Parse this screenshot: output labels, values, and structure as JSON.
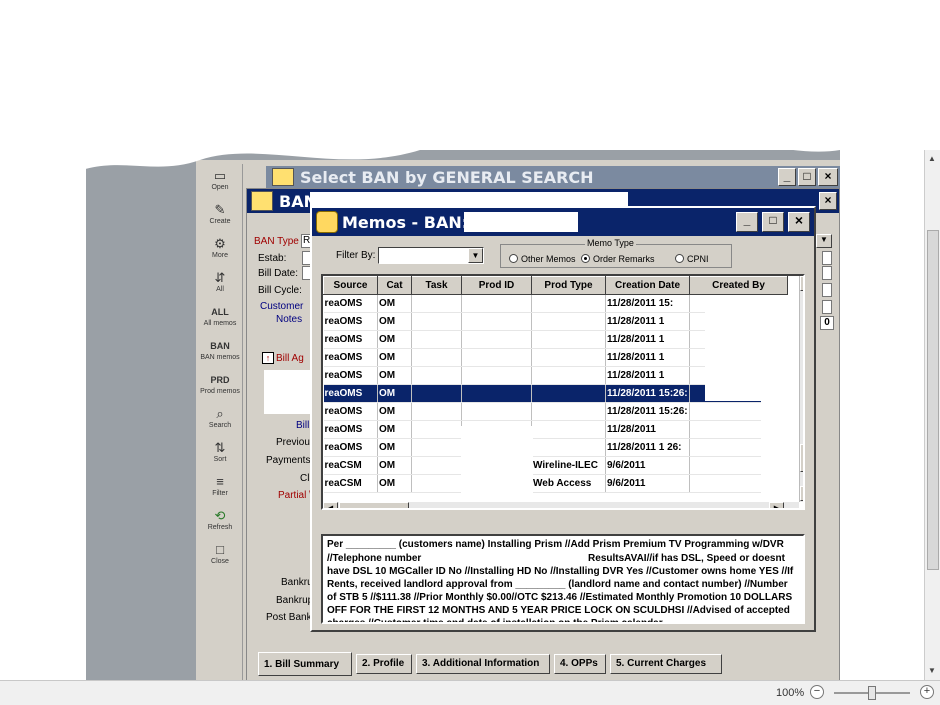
{
  "back_window": {
    "title": "Select BAN by GENERAL SEARCH"
  },
  "ban_window": {
    "title": "BAN",
    "labels": {
      "ban_type": "BAN Type",
      "estab": "Estab:",
      "bill_date": "Bill Date:",
      "bill_cycle": "Bill Cycle:",
      "customer": "Customer",
      "notes": "Notes",
      "bill_ag": "Bill Ag",
      "bill": "Bill",
      "previous": "Previou",
      "payments": "Payments",
      "ch": "Cl",
      "partial": "Partial \\",
      "bankru1": "Bankru",
      "bankru2": "Bankrup",
      "post_bank": "Post Bank",
      "ban_type_value": "R",
      "side_value": "0"
    }
  },
  "toolbar": {
    "items": [
      {
        "icon": "folder-open-icon",
        "glyph": "▭",
        "label": "Open"
      },
      {
        "icon": "create-icon",
        "glyph": "✎",
        "label": "Create"
      },
      {
        "icon": "more-icon",
        "glyph": "⚙",
        "label": "More"
      },
      {
        "icon": "all-icon",
        "glyph": "⇵",
        "label": "All"
      },
      {
        "icon": "all-memos-icon",
        "glyph": "ALL",
        "label": "All memos"
      },
      {
        "icon": "ban-memos-icon",
        "glyph": "BAN",
        "label": "BAN memos"
      },
      {
        "icon": "prod-memos-icon",
        "glyph": "PRD",
        "label": "Prod memos"
      },
      {
        "icon": "search-icon",
        "glyph": "⌕",
        "label": "Search"
      },
      {
        "icon": "sort-icon",
        "glyph": "⇅",
        "label": "Sort"
      },
      {
        "icon": "filter-icon",
        "glyph": "≡",
        "label": "Filter"
      },
      {
        "icon": "refresh-icon",
        "glyph": "⟲",
        "label": "Refresh"
      },
      {
        "icon": "close-icon",
        "glyph": "□",
        "label": "Close"
      }
    ]
  },
  "memos": {
    "title": "Memos  - BAN:",
    "filter_label": "Filter By:",
    "memo_type_legend": "Memo Type",
    "radios": [
      {
        "label": "Other Memos",
        "checked": false
      },
      {
        "label": "Order Remarks",
        "checked": true
      },
      {
        "label": "CPNI",
        "checked": false
      }
    ],
    "columns": [
      "Source",
      "Cat",
      "Task",
      "Prod ID",
      "Prod Type",
      "Creation Date",
      "Created By"
    ],
    "rows": [
      {
        "prefix": "rea",
        "source": "OMS",
        "cat": "OM",
        "task": "",
        "prod_id": "",
        "prod_type": "",
        "date": "11/28/2011 15:",
        "by": ""
      },
      {
        "prefix": "rea",
        "source": "OMS",
        "cat": "OM",
        "task": "",
        "prod_id": "",
        "prod_type": "",
        "date": "11/28/2011 1",
        "by": ""
      },
      {
        "prefix": "rea",
        "source": "OMS",
        "cat": "OM",
        "task": "",
        "prod_id": "",
        "prod_type": "",
        "date": "11/28/2011 1",
        "by": ""
      },
      {
        "prefix": "rea",
        "source": "OMS",
        "cat": "OM",
        "task": "",
        "prod_id": "",
        "prod_type": "",
        "date": "11/28/2011 1",
        "by": ""
      },
      {
        "prefix": "rea",
        "source": "OMS",
        "cat": "OM",
        "task": "",
        "prod_id": "",
        "prod_type": "",
        "date": "11/28/2011 1",
        "by": ""
      },
      {
        "prefix": "rea",
        "source": "OMS",
        "cat": "OM",
        "task": "",
        "prod_id": "",
        "prod_type": "",
        "date": "11/28/2011 15:26:",
        "by": "",
        "selected": true
      },
      {
        "prefix": "rea",
        "source": "OMS",
        "cat": "OM",
        "task": "",
        "prod_id": "",
        "prod_type": "",
        "date": "11/28/2011 15:26:",
        "by": ""
      },
      {
        "prefix": "rea",
        "source": "OMS",
        "cat": "OM",
        "task": "",
        "prod_id": "",
        "prod_type": "",
        "date": "11/28/2011",
        "by": ""
      },
      {
        "prefix": "rea",
        "source": "OMS",
        "cat": "OM",
        "task": "",
        "prod_id": "",
        "prod_type": "",
        "date": "11/28/2011 1  26:",
        "by": ""
      },
      {
        "prefix": "rea",
        "source": "CSM",
        "cat": "OM",
        "task": "",
        "prod_id": "",
        "prod_type": "Wireline-ILEC",
        "date": "9/6/2011",
        "by": ""
      },
      {
        "prefix": "rea",
        "source": "CSM",
        "cat": "OM",
        "task": "",
        "prod_id": "",
        "prod_type": "Web Access",
        "date": "9/6/2011",
        "by": ""
      }
    ],
    "note": {
      "part1": "Per _________ (customers name) Installing Prism //Add Prism Premium TV Programming w/DVR //Telephone number ",
      "part2": "ResultsAVAI//if has DSL, Speed or doesnt have DSL 10 MGCaller ID No //Installing HD No //Installing DVR Yes //Customer owns home YES  //If Rents, received landlord approval from _________ (landlord name and contact number) //Number of STB 5 //$111.38 //Prior Monthly $0.00//OTC $213.46 //Estimated Monthly Promotion 10 DOLLARS OFF FOR THE FIRST 12 MONTHS AND 5 YEAR PRICE LOCK ON SCULDHSI //Advised of accepted charges //Customer time and date of installation on the Prism calendar"
    }
  },
  "tabs": [
    "1. Bill Summary",
    "2. Profile",
    "3. Additional Information",
    "4. OPPs",
    "5. Current Charges"
  ],
  "statusbar": {
    "zoom": "100%"
  }
}
